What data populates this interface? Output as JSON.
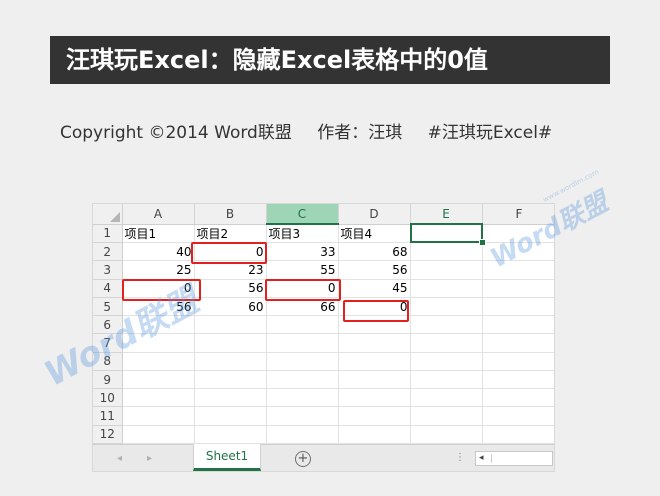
{
  "banner": {
    "title": "汪琪玩Excel：隐藏Excel表格中的0值"
  },
  "copyright": {
    "line": "Copyright ©2014 Word联盟",
    "author": "作者：汪琪",
    "tag": "#汪琪玩Excel#"
  },
  "spreadsheet": {
    "columns": [
      "A",
      "B",
      "C",
      "D",
      "E",
      "F"
    ],
    "rows": [
      {
        "num": "1",
        "cells": [
          "项目1",
          "项目2",
          "项目3",
          "项目4",
          "",
          ""
        ]
      },
      {
        "num": "2",
        "cells": [
          "40",
          "0",
          "33",
          "68",
          "",
          ""
        ]
      },
      {
        "num": "3",
        "cells": [
          "25",
          "23",
          "55",
          "56",
          "",
          ""
        ]
      },
      {
        "num": "4",
        "cells": [
          "0",
          "56",
          "0",
          "45",
          "",
          ""
        ]
      },
      {
        "num": "5",
        "cells": [
          "56",
          "60",
          "66",
          "0",
          "",
          ""
        ]
      },
      {
        "num": "6",
        "cells": [
          "",
          "",
          "",
          "",
          "",
          ""
        ]
      },
      {
        "num": "7",
        "cells": [
          "",
          "",
          "",
          "",
          "",
          ""
        ]
      },
      {
        "num": "8",
        "cells": [
          "",
          "",
          "",
          "",
          "",
          ""
        ]
      },
      {
        "num": "9",
        "cells": [
          "",
          "",
          "",
          "",
          "",
          ""
        ]
      },
      {
        "num": "10",
        "cells": [
          "",
          "",
          "",
          "",
          "",
          ""
        ]
      },
      {
        "num": "11",
        "cells": [
          "",
          "",
          "",
          "",
          "",
          ""
        ]
      },
      {
        "num": "12",
        "cells": [
          "",
          "",
          "",
          "",
          "",
          ""
        ]
      }
    ],
    "selected_cell": "E1",
    "highlighted_zero_cells": [
      "B2",
      "A4",
      "C4",
      "D5"
    ]
  },
  "tabs": {
    "sheet1": "Sheet1",
    "add_sheet_icon": "plus-circle-icon"
  },
  "watermark": {
    "text1": "Word联盟",
    "text2": "Word联盟",
    "url": "www.wordlm.com"
  },
  "colors": {
    "excel_green": "#217346",
    "highlight_red": "#e2201f",
    "banner_bg": "#333333"
  }
}
